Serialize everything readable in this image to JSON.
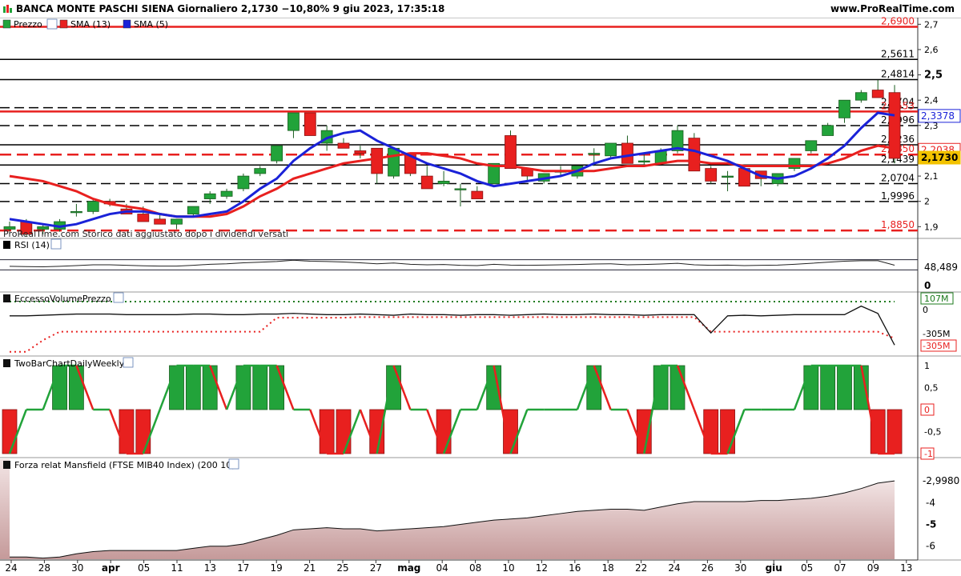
{
  "header": {
    "title": "BANCA MONTE PASCHI SIENA Giornaliero 2,1730 −10,80% 9 giu 2023, 17:35:18",
    "site": "www.ProRealTime.com"
  },
  "colors": {
    "up": "#22a33a",
    "down": "#e8201f",
    "sma13": "#e8201f",
    "sma5": "#1a22d8",
    "last": "#f2c200",
    "bg": "#ffffff"
  },
  "icons": [
    "chart-icon",
    "wrench-icon"
  ],
  "price_panel": {
    "legend": [
      {
        "label": "Prezzo",
        "color": "#22a33a"
      },
      {
        "label": "SMA (13)",
        "color": "#e8201f"
      },
      {
        "label": "SMA (5)",
        "color": "#1a22d8"
      }
    ],
    "watermark": "ProRealTime.com  Storico dati aggiustato dopo i dividendi versati",
    "ticks": [
      "2,7",
      "2,6",
      "2,5",
      "2,4",
      "2,3",
      "2,2",
      "2,1",
      "2",
      "1,9"
    ],
    "levels": [
      {
        "label": "2,6900",
        "value": 2.69,
        "style": "solid-red"
      },
      {
        "label": "2,5611",
        "value": 2.5611,
        "style": "solid"
      },
      {
        "label": "2,4814",
        "value": 2.4814,
        "style": "solid"
      },
      {
        "label": "2,3704",
        "value": 2.3704,
        "style": "dash"
      },
      {
        "label": "2,3553",
        "value": 2.3553,
        "style": "solid-red"
      },
      {
        "label": "2,2996",
        "value": 2.2996,
        "style": "dash"
      },
      {
        "label": "2,2236",
        "value": 2.2236,
        "style": "solid"
      },
      {
        "label": "2,1850",
        "value": 2.185,
        "style": "dash-red"
      },
      {
        "label": "2,1439",
        "value": 2.1439,
        "style": "solid"
      },
      {
        "label": "2,0704",
        "value": 2.0704,
        "style": "dash"
      },
      {
        "label": "1,9996",
        "value": 1.9996,
        "style": "dash"
      },
      {
        "label": "1,8850",
        "value": 1.885,
        "style": "dash-red"
      }
    ],
    "badges": [
      {
        "label": "2,3378",
        "value": 2.3378,
        "color": "#1a22d8"
      },
      {
        "label": "2,2038",
        "value": 2.2038,
        "color": "#e8201f"
      },
      {
        "label": "2,1730",
        "value": 2.173,
        "color": "#f2c200"
      }
    ]
  },
  "rsi_panel": {
    "legend": "RSI (14)",
    "ticks": [
      "0"
    ],
    "badge": "48,489"
  },
  "volume_panel": {
    "legend": "EccessoVolumePrezzo",
    "badges": [
      "107M",
      "0",
      "-305M",
      "-305M"
    ]
  },
  "twobar_panel": {
    "legend": "TwoBarChartDailyWeekly",
    "ticks": [
      "1",
      "0,5",
      "0",
      "-0,5",
      "-1"
    ]
  },
  "mansfield_panel": {
    "legend": "Forza relat Mansfield (FTSE MIB40 Index) (200 10)",
    "ticks": [
      "-4",
      "-5",
      "-6"
    ],
    "badge": "-2,9980"
  },
  "x_axis": {
    "labels": [
      "24",
      "28",
      "30",
      "apr",
      "05",
      "11",
      "13",
      "17",
      "19",
      "21",
      "25",
      "27",
      "mag",
      "04",
      "08",
      "10",
      "12",
      "16",
      "18",
      "22",
      "24",
      "26",
      "30",
      "giu",
      "05",
      "07",
      "09",
      "13"
    ],
    "bold": [
      "apr",
      "mag",
      "giu"
    ]
  },
  "chart_data": [
    {
      "type": "candlestick",
      "title": "BANCA MONTE PASCHI SIENA Giornaliero 2,1730 −10,80% 9 giu 2023, 17:35:18",
      "ylim": [
        1.86,
        2.72
      ],
      "x": [
        "23/3",
        "24/3",
        "27/3",
        "28/3",
        "29/3",
        "30/3",
        "31/3",
        "3/4",
        "4/4",
        "5/4",
        "6/4",
        "11/4",
        "12/4",
        "13/4",
        "14/4",
        "17/4",
        "18/4",
        "19/4",
        "20/4",
        "21/4",
        "24/4",
        "25/4",
        "26/4",
        "27/4",
        "28/4",
        "2/5",
        "3/5",
        "4/5",
        "5/5",
        "8/5",
        "9/5",
        "10/5",
        "11/5",
        "12/5",
        "15/5",
        "16/5",
        "17/5",
        "18/5",
        "19/5",
        "22/5",
        "23/5",
        "24/5",
        "25/5",
        "26/5",
        "29/5",
        "30/5",
        "31/5",
        "1/6",
        "2/6",
        "5/6",
        "6/6",
        "7/6",
        "8/6",
        "9/6"
      ],
      "ohlc": [
        [
          1.89,
          1.92,
          1.88,
          1.9
        ],
        [
          1.92,
          1.93,
          1.86,
          1.87
        ],
        [
          1.89,
          1.91,
          1.87,
          1.9
        ],
        [
          1.89,
          1.93,
          1.88,
          1.92
        ],
        [
          1.96,
          1.99,
          1.94,
          1.96
        ],
        [
          1.96,
          2.01,
          1.95,
          2.0
        ],
        [
          2.0,
          2.01,
          1.98,
          1.99
        ],
        [
          1.97,
          1.99,
          1.95,
          1.95
        ],
        [
          1.95,
          1.98,
          1.92,
          1.92
        ],
        [
          1.93,
          1.95,
          1.91,
          1.91
        ],
        [
          1.91,
          1.93,
          1.89,
          1.93
        ],
        [
          1.95,
          1.98,
          1.94,
          1.98
        ],
        [
          2.01,
          2.04,
          1.99,
          2.03
        ],
        [
          2.02,
          2.05,
          2.01,
          2.04
        ],
        [
          2.05,
          2.11,
          2.04,
          2.1
        ],
        [
          2.11,
          2.14,
          2.1,
          2.13
        ],
        [
          2.16,
          2.22,
          2.15,
          2.22
        ],
        [
          2.28,
          2.35,
          2.25,
          2.35
        ],
        [
          2.35,
          2.33,
          2.26,
          2.26
        ],
        [
          2.23,
          2.3,
          2.2,
          2.28
        ],
        [
          2.23,
          2.25,
          2.21,
          2.21
        ],
        [
          2.2,
          2.22,
          2.17,
          2.19
        ],
        [
          2.21,
          2.21,
          2.07,
          2.11
        ],
        [
          2.1,
          2.21,
          2.09,
          2.21
        ],
        [
          2.19,
          2.19,
          2.1,
          2.11
        ],
        [
          2.1,
          2.14,
          2.06,
          2.05
        ],
        [
          2.07,
          2.12,
          2.06,
          2.08
        ],
        [
          2.05,
          2.07,
          1.98,
          2.05
        ],
        [
          2.04,
          2.06,
          2.02,
          2.01
        ],
        [
          2.07,
          2.14,
          2.07,
          2.15
        ],
        [
          2.26,
          2.28,
          2.18,
          2.13
        ],
        [
          2.13,
          2.13,
          2.08,
          2.1
        ],
        [
          2.08,
          2.1,
          2.07,
          2.11
        ],
        [
          2.12,
          2.14,
          2.1,
          2.12
        ],
        [
          2.1,
          2.13,
          2.09,
          2.14
        ],
        [
          2.19,
          2.21,
          2.14,
          2.19
        ],
        [
          2.18,
          2.21,
          2.17,
          2.23
        ],
        [
          2.23,
          2.26,
          2.17,
          2.15
        ],
        [
          2.16,
          2.19,
          2.14,
          2.16
        ],
        [
          2.15,
          2.21,
          2.15,
          2.2
        ],
        [
          2.2,
          2.3,
          2.19,
          2.28
        ],
        [
          2.25,
          2.27,
          2.13,
          2.12
        ],
        [
          2.13,
          2.14,
          2.07,
          2.08
        ],
        [
          2.1,
          2.12,
          2.04,
          2.1
        ],
        [
          2.13,
          2.13,
          2.06,
          2.06
        ],
        [
          2.12,
          2.12,
          2.06,
          2.09
        ],
        [
          2.07,
          2.11,
          2.06,
          2.11
        ],
        [
          2.13,
          2.17,
          2.12,
          2.17
        ],
        [
          2.2,
          2.24,
          2.19,
          2.24
        ],
        [
          2.26,
          2.31,
          2.27,
          2.3
        ],
        [
          2.33,
          2.4,
          2.31,
          2.4
        ],
        [
          2.4,
          2.44,
          2.39,
          2.43
        ],
        [
          2.44,
          2.48,
          2.41,
          2.41
        ],
        [
          2.43,
          2.46,
          2.15,
          2.17
        ]
      ],
      "series": [
        {
          "name": "SMA (13)",
          "values": [
            2.1,
            2.09,
            2.08,
            2.06,
            2.04,
            2.01,
            1.99,
            1.98,
            1.97,
            1.95,
            1.94,
            1.94,
            1.94,
            1.95,
            1.98,
            2.02,
            2.05,
            2.09,
            2.11,
            2.13,
            2.15,
            2.16,
            2.17,
            2.18,
            2.19,
            2.19,
            2.18,
            2.17,
            2.15,
            2.14,
            2.14,
            2.13,
            2.12,
            2.12,
            2.12,
            2.12,
            2.13,
            2.14,
            2.14,
            2.15,
            2.16,
            2.16,
            2.15,
            2.15,
            2.14,
            2.14,
            2.14,
            2.14,
            2.14,
            2.15,
            2.17,
            2.2,
            2.22,
            2.21
          ]
        },
        {
          "name": "SMA (5)",
          "values": [
            1.93,
            1.92,
            1.91,
            1.9,
            1.91,
            1.93,
            1.95,
            1.96,
            1.96,
            1.95,
            1.94,
            1.94,
            1.95,
            1.96,
            2.0,
            2.05,
            2.09,
            2.16,
            2.21,
            2.25,
            2.27,
            2.28,
            2.24,
            2.21,
            2.18,
            2.15,
            2.13,
            2.11,
            2.08,
            2.06,
            2.07,
            2.08,
            2.09,
            2.1,
            2.12,
            2.15,
            2.17,
            2.18,
            2.19,
            2.2,
            2.21,
            2.2,
            2.18,
            2.16,
            2.13,
            2.1,
            2.09,
            2.1,
            2.13,
            2.17,
            2.22,
            2.29,
            2.35,
            2.34
          ]
        }
      ]
    },
    {
      "type": "line",
      "title": "RSI (14)",
      "ylim": [
        0,
        100
      ],
      "series": [
        {
          "name": "RSI (14)",
          "values": [
            44,
            43,
            42,
            44,
            47,
            50,
            50,
            48,
            46,
            45,
            45,
            48,
            52,
            54,
            58,
            60,
            63,
            68,
            64,
            63,
            61,
            58,
            54,
            57,
            52,
            50,
            51,
            48,
            47,
            52,
            49,
            48,
            49,
            50,
            51,
            53,
            54,
            50,
            51,
            53,
            56,
            50,
            48,
            49,
            47,
            48,
            49,
            52,
            56,
            60,
            64,
            66,
            66,
            48.489
          ]
        }
      ]
    },
    {
      "type": "line",
      "title": "EccessoVolumePrezzo",
      "series": [
        {
          "name": "EccessoVolumePrezzo",
          "values": [
            -10,
            -10,
            -5,
            0,
            5,
            5,
            5,
            0,
            0,
            0,
            0,
            5,
            5,
            0,
            0,
            5,
            5,
            10,
            5,
            0,
            0,
            5,
            0,
            -5,
            5,
            0,
            0,
            -5,
            0,
            0,
            -5,
            0,
            5,
            0,
            0,
            5,
            0,
            0,
            -5,
            0,
            0,
            0,
            -150,
            -10,
            -5,
            -10,
            -5,
            0,
            0,
            0,
            0,
            70,
            10,
            -250
          ]
        },
        {
          "name": "max",
          "values": [
            107,
            107,
            107,
            107,
            107,
            107,
            107,
            107,
            107,
            107,
            107,
            107,
            107,
            107,
            107,
            107,
            107,
            107,
            107,
            107,
            107,
            107,
            107,
            107,
            107,
            107,
            107,
            107,
            107,
            107,
            107,
            107,
            107,
            107,
            107,
            107,
            107,
            107,
            107,
            107,
            107,
            107,
            107,
            107,
            107,
            107,
            107,
            107,
            107,
            107,
            107,
            107,
            107,
            107
          ]
        },
        {
          "name": "min",
          "values": [
            -305,
            -305,
            -210,
            -140,
            -140,
            -140,
            -140,
            -140,
            -140,
            -140,
            -140,
            -140,
            -140,
            -140,
            -140,
            -140,
            -25,
            -25,
            -25,
            -25,
            -25,
            -20,
            -20,
            -20,
            -20,
            -20,
            -20,
            -20,
            -20,
            -20,
            -20,
            -20,
            -20,
            -20,
            -20,
            -20,
            -20,
            -20,
            -20,
            -20,
            -20,
            -20,
            -140,
            -140,
            -140,
            -140,
            -140,
            -140,
            -140,
            -140,
            -140,
            -140,
            -140,
            -195
          ]
        }
      ]
    },
    {
      "type": "bar",
      "title": "TwoBarChartDailyWeekly",
      "ylim": [
        -1.1,
        1.1
      ],
      "values": [
        -1,
        0,
        0,
        1,
        1,
        0,
        0,
        -1,
        -1,
        0,
        1,
        1,
        1,
        0,
        1,
        1,
        1,
        0,
        0,
        -1,
        -1,
        0,
        -1,
        1,
        0,
        0,
        -1,
        0,
        0,
        1,
        -1,
        0,
        0,
        0,
        0,
        1,
        0,
        0,
        -1,
        1,
        1,
        0,
        -1,
        -1,
        0,
        0,
        0,
        0,
        1,
        1,
        1,
        1,
        -1,
        -1
      ]
    },
    {
      "type": "area",
      "title": "Forza relat Mansfield (FTSE MIB40 Index) (200 10)",
      "ylim": [
        -6.6,
        -2.0
      ],
      "values": [
        -6.5,
        -6.5,
        -6.55,
        -6.5,
        -6.35,
        -6.25,
        -6.2,
        -6.2,
        -6.2,
        -6.2,
        -6.2,
        -6.1,
        -6.0,
        -6.0,
        -5.9,
        -5.7,
        -5.5,
        -5.25,
        -5.2,
        -5.15,
        -5.2,
        -5.2,
        -5.3,
        -5.25,
        -5.2,
        -5.15,
        -5.1,
        -5.0,
        -4.9,
        -4.8,
        -4.75,
        -4.7,
        -4.6,
        -4.5,
        -4.4,
        -4.35,
        -4.3,
        -4.3,
        -4.35,
        -4.2,
        -4.05,
        -3.95,
        -3.95,
        -3.95,
        -3.95,
        -3.9,
        -3.9,
        -3.85,
        -3.8,
        -3.7,
        -3.55,
        -3.35,
        -3.1,
        -2.998
      ]
    }
  ]
}
